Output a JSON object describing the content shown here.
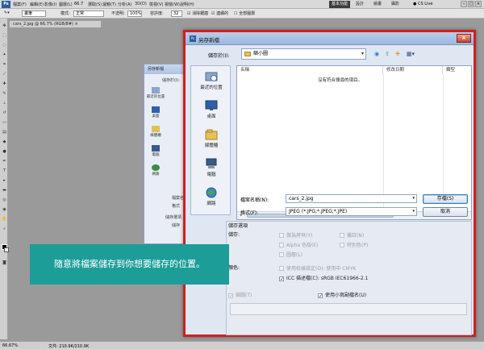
{
  "menubar": {
    "logo": "Ps",
    "zoom": "66.7",
    "items": [
      "檔案(F)",
      "編輯(E)",
      "影像(I)",
      "圖層(L)",
      "選取(S)",
      "濾鏡(T)",
      "分析(A)",
      "3D(D)",
      "檢視(V)",
      "視窗(W)",
      "說明(H)"
    ],
    "workspaces": [
      "基本功能",
      "設計",
      "繪畫",
      "攝影"
    ],
    "cs_live": "CS Live"
  },
  "options": {
    "brush_mode": "畫筆",
    "mode_label": "模式:",
    "mode_value": "正常",
    "opacity_label": "不透明:",
    "opacity_value": "100%",
    "flow_label": "流量:",
    "flow_value": "100%",
    "tolerance_label": "容許度:",
    "tolerance_value": "32",
    "antialias_label": "消除鋸齒",
    "contiguous_label": "連續的",
    "sample_all_label": "全部圖層"
  },
  "document_tab": "cars_2.jpg @ 66.7% (RGB/8#) ×",
  "status": {
    "zoom": "66.67%",
    "doc": "文件: 210.9K/210.9K"
  },
  "bg_dialog": {
    "title": "另存新檔",
    "save_in": "儲存於(I):",
    "nav": [
      "最近的位置",
      "桌面",
      "媒體櫃",
      "電腦",
      "網路"
    ],
    "filename": "檔案名稱",
    "format": "格式",
    "options": "儲存選項",
    "save": "儲存",
    "color": "顏色"
  },
  "dialog": {
    "title": "另存新檔",
    "close": "×",
    "save_in_label": "儲存於(I):",
    "save_in_value": "縮小圖",
    "places": [
      "最近的位置",
      "桌面",
      "媒體櫃",
      "電腦",
      "網路"
    ],
    "columns": [
      "名稱",
      "修改日期",
      "類型"
    ],
    "empty_message": "沒有符合搜尋的項目。",
    "filename_label": "檔案名稱(N):",
    "filename_value": "cars_2.jpg",
    "format_label": "格式(F):",
    "format_value": "JPEG (*.JPG;*.JPEG;*.JPE)",
    "save_button": "存檔(S)",
    "cancel_button": "取消",
    "save_options_label": "儲存選項",
    "save_label": "儲存:",
    "checkboxes": {
      "as_copy": "做為拷貝(Y)",
      "notes": "備註(N)",
      "alpha": "Alpha 色版(E)",
      "spot": "特別色(P)",
      "layers": "圖層(L)",
      "proof_setup": "使用校樣設定(O): 使用中 CMYK",
      "icc_profile": "ICC 描述檔(C): sRGB IEC61966-2.1",
      "thumbnail": "縮圖(T)",
      "lower_ext": "使用小寫副檔名(U)"
    },
    "color_label": "顏色:"
  },
  "banner": {
    "text": "隨意將檔案儲存到你想要儲存的位置。"
  }
}
